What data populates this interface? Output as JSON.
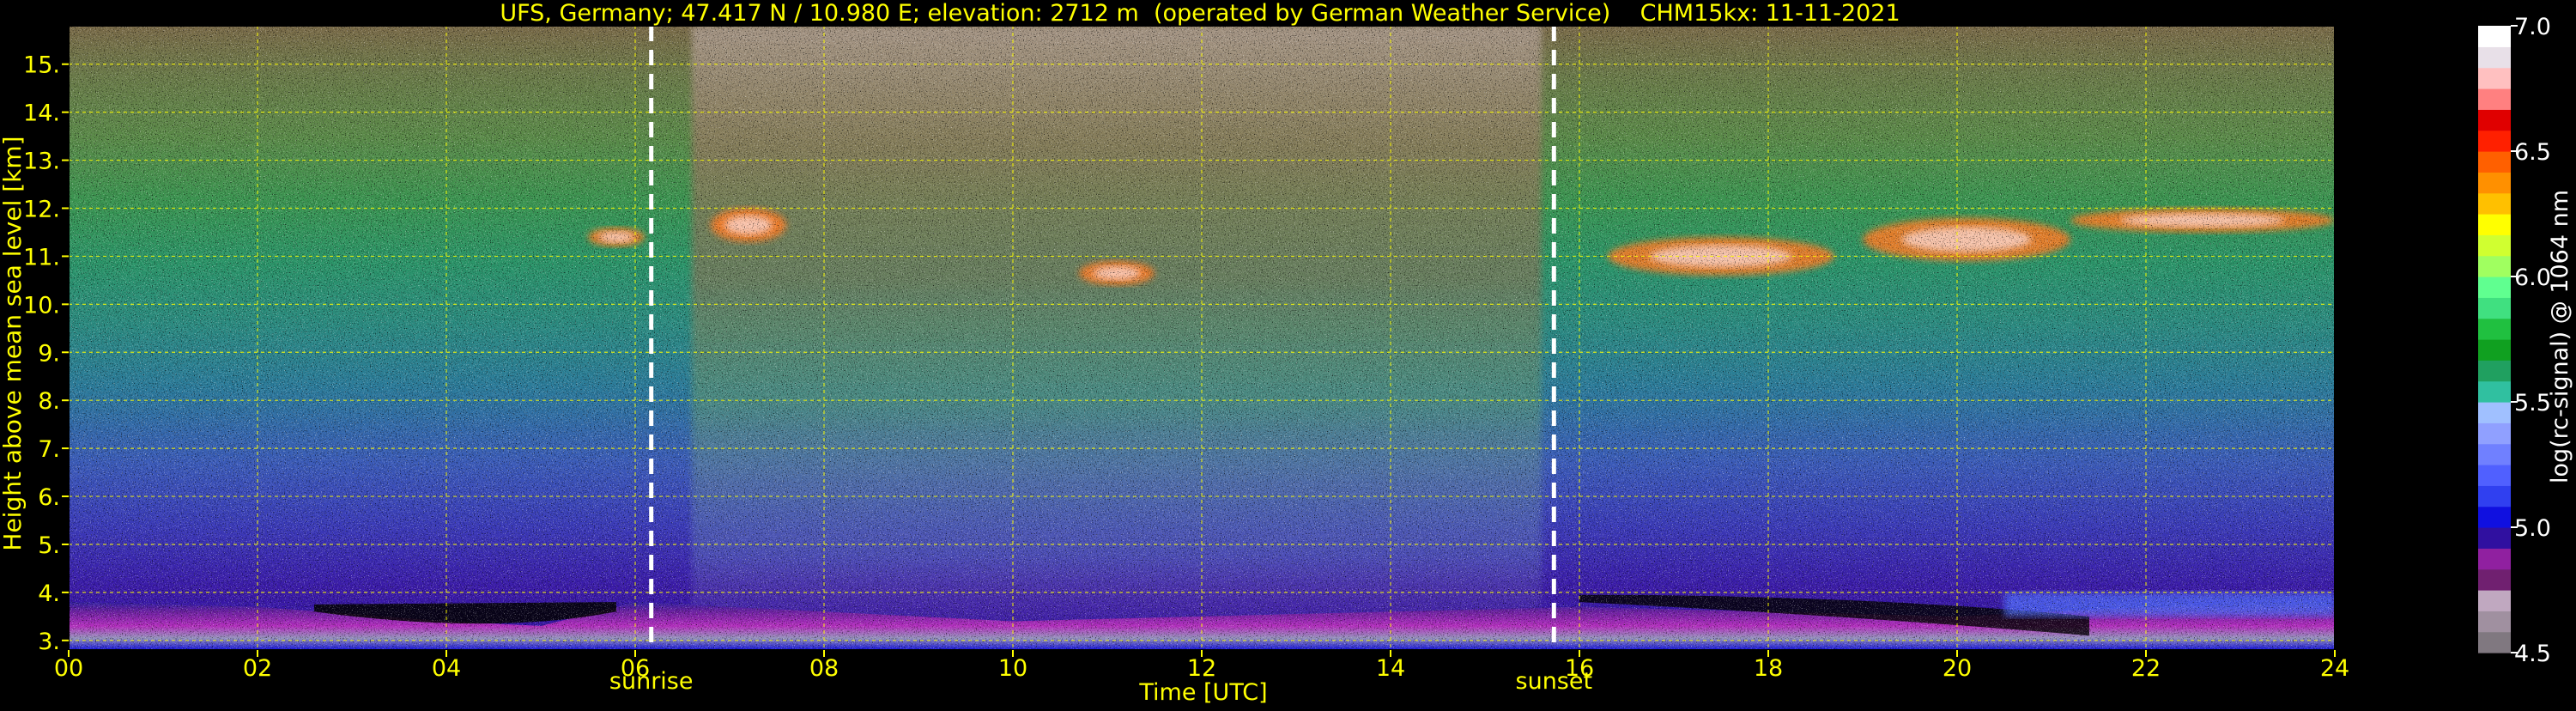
{
  "title": "UFS, Germany; 47.417 N / 10.980 E; elevation: 2712 m  (operated by German Weather Service)    CHM15kx: 11-11-2021",
  "colors": {
    "text": "#ffff00",
    "grid": "#ffff00",
    "background": "#000000",
    "marker_lines": "#ffffff"
  },
  "chart_data": {
    "type": "heatmap",
    "title": "UFS, Germany; 47.417 N / 10.980 E; elevation: 2712 m  (operated by German Weather Service)    CHM15kx: 11-11-2021",
    "xlabel": "Time [UTC]",
    "ylabel": "Height above mean sea level [km]",
    "xlim": [
      0,
      24
    ],
    "ylim": [
      2.8,
      15.8
    ],
    "x_ticks": [
      0,
      2,
      4,
      6,
      8,
      10,
      12,
      14,
      16,
      18,
      20,
      22,
      24
    ],
    "x_tick_labels": [
      "00",
      "02",
      "04",
      "06",
      "08",
      "10",
      "12",
      "14",
      "16",
      "18",
      "20",
      "22",
      "24"
    ],
    "y_ticks": [
      3,
      4,
      5,
      6,
      7,
      8,
      9,
      10,
      11,
      12,
      13,
      14,
      15
    ],
    "y_tick_labels": [
      "3.",
      "4.",
      "5.",
      "6.",
      "7.",
      "8.",
      "9.",
      "10.",
      "11.",
      "12.",
      "13.",
      "14.",
      "15."
    ],
    "grid": true,
    "markers": [
      {
        "label": "sunrise",
        "x": 6.17
      },
      {
        "label": "sunset",
        "x": 15.73
      }
    ],
    "colorbar": {
      "label": "log(rc-signal) @ 1064 nm",
      "range": [
        4.5,
        7.0
      ],
      "ticks": [
        4.5,
        5.0,
        5.5,
        6.0,
        6.5,
        7.0
      ],
      "tick_labels": [
        "4.5",
        "5.0",
        "5.5",
        "6.0",
        "6.5",
        "7.0"
      ],
      "colors": [
        "#807880",
        "#a090a0",
        "#c0a8c0",
        "#702070",
        "#9020a0",
        "#3010a0",
        "#1010e0",
        "#3040f0",
        "#5060ff",
        "#7080ff",
        "#90a0ff",
        "#a0c0ff",
        "#30c0a0",
        "#20a060",
        "#10a020",
        "#20c040",
        "#40e080",
        "#60ff90",
        "#a0ff60",
        "#d0ff30",
        "#ffff00",
        "#ffc000",
        "#ff9000",
        "#ff6000",
        "#ff2000",
        "#e00000",
        "#ff8080",
        "#ffc0c0",
        "#e8e0e8",
        "#ffffff"
      ]
    },
    "cloud_layers": [
      {
        "start": 5.5,
        "end": 6.1,
        "base_km": 11.2,
        "top_km": 11.6
      },
      {
        "start": 6.8,
        "end": 7.6,
        "base_km": 11.3,
        "top_km": 12.0
      },
      {
        "start": 10.7,
        "end": 11.5,
        "base_km": 10.4,
        "top_km": 10.9
      },
      {
        "start": 16.3,
        "end": 18.7,
        "base_km": 10.6,
        "top_km": 11.4
      },
      {
        "start": 19.0,
        "end": 21.2,
        "base_km": 10.9,
        "top_km": 11.8
      },
      {
        "start": 21.2,
        "end": 24.0,
        "base_km": 11.5,
        "top_km": 12.0
      }
    ],
    "boundary_layer_top_km": [
      {
        "time": 0,
        "value": 3.8
      },
      {
        "time": 2,
        "value": 3.7
      },
      {
        "time": 3,
        "value": 3.55
      },
      {
        "time": 4,
        "value": 3.4
      },
      {
        "time": 5,
        "value": 3.3
      },
      {
        "time": 6,
        "value": 3.8
      },
      {
        "time": 8,
        "value": 3.6
      },
      {
        "time": 10,
        "value": 3.4
      },
      {
        "time": 12,
        "value": 3.5
      },
      {
        "time": 14,
        "value": 3.6
      },
      {
        "time": 16,
        "value": 3.7
      },
      {
        "time": 18,
        "value": 3.6
      },
      {
        "time": 20,
        "value": 3.5
      },
      {
        "time": 22,
        "value": 3.7
      },
      {
        "time": 24,
        "value": 3.8
      }
    ]
  }
}
